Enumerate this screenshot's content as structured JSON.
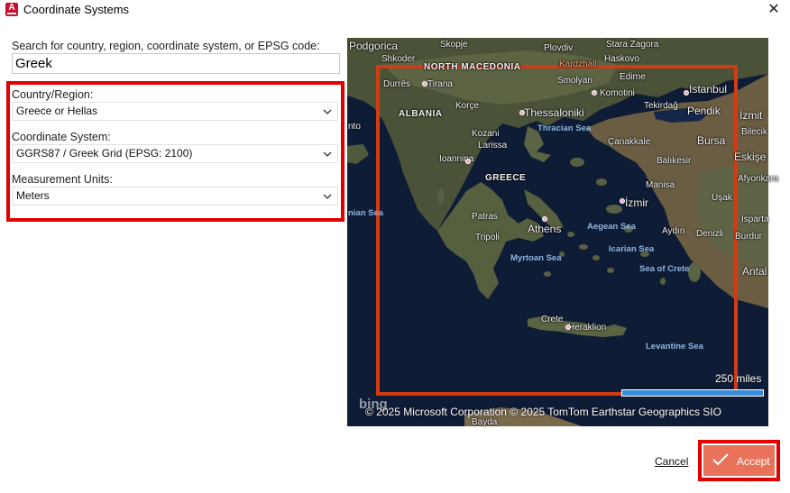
{
  "window": {
    "title": "Coordinate Systems",
    "app_icon_letter": "A",
    "close_glyph": "✕"
  },
  "search": {
    "label": "Search for country, region, coordinate system, or EPSG code:",
    "value": "Greek"
  },
  "country": {
    "label": "Country/Region:",
    "value": "Greece or Hellas"
  },
  "coordinate_system": {
    "label": "Coordinate System:",
    "value": "GGRS87 / Greek Grid (EPSG: 2100)"
  },
  "units": {
    "label": "Measurement Units:",
    "value": "Meters"
  },
  "map": {
    "labels": {
      "podgorica": "Podgorica",
      "skopje": "Skopje",
      "plovdiv": "Plovdiv",
      "stara_zagora": "Stara Zagora",
      "shkoder": "Shkoder",
      "haskovo": "Haskovo",
      "north_macedonia": "NORTH MACEDONIA",
      "kardzhali": "Kardzhali",
      "durres": "Durrës",
      "tirana": "Tirana",
      "smolyan": "Smolyan",
      "edirne": "Edirne",
      "istanbul": "Istanbul",
      "komotini": "Komotini",
      "albania": "ALBANIA",
      "korce": "Korçe",
      "thessaloniki": "Thessaloniki",
      "tekirdag": "Tekirdağ",
      "pendik": "Pendik",
      "izmit": "İzmit",
      "thracian_sea": "Thracian Sea",
      "anto": "nto",
      "kozani": "Kozani",
      "canakkale": "Çanakkale",
      "bursa": "Bursa",
      "bilecik": "Bilecik",
      "larissa": "Larissa",
      "ioannina": "Ioannina",
      "balikesir": "Balıkesir",
      "eskisehir": "Eskişe",
      "greece": "GREECE",
      "manisa": "Manisa",
      "afyonkara": "Afyonkara",
      "izmir": "İzmir",
      "usak": "Uşak",
      "ionian_sea": "nian Sea",
      "patras": "Patras",
      "athens": "Athens",
      "aegean_sea": "Aegean Sea",
      "isparta": "Isparta",
      "tripoli": "Tripoli",
      "aydin": "Aydın",
      "denizli": "Denizli",
      "burdur": "Burdur",
      "icarian_sea": "Icarian Sea",
      "myrtoan_sea": "Myrtoan Sea",
      "sea_of_crete": "Sea of Crete",
      "antal": "Antal",
      "crete": "Crete",
      "heraklion": "Heraklion",
      "levantine_sea": "Levantine Sea",
      "bayda": "Bayda"
    },
    "scale_label": "250 miles",
    "attribution": "© 2025 Microsoft Corporation  © 2025 TomTom   Earthstar Geographics  SIO",
    "bing_logo": "bing"
  },
  "buttons": {
    "cancel": "Cancel",
    "accept": "Accept"
  },
  "colors": {
    "highlight": "#e00000",
    "accept_bg": "#e8735a",
    "frame": "#d23c14"
  }
}
